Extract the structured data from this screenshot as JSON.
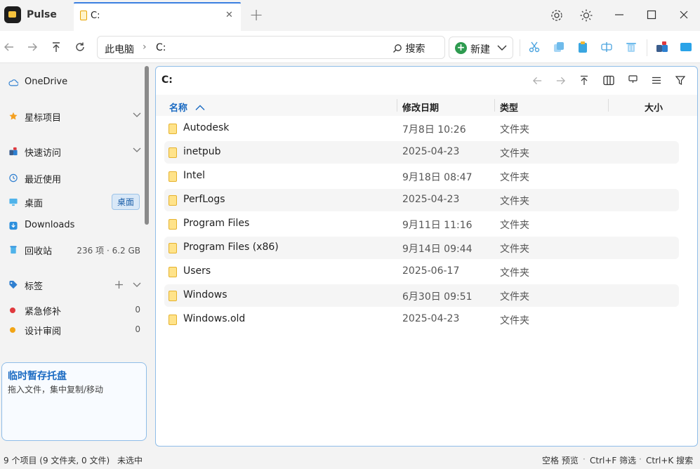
{
  "app": {
    "title": "Pulse"
  },
  "tab": {
    "label": "C:",
    "close": "✕",
    "add": "+"
  },
  "toolbar": {
    "breadcrumb": [
      "此电脑",
      "C:"
    ],
    "search_label": "搜索",
    "new_label": "新建"
  },
  "sidebar": {
    "onedrive": "OneDrive",
    "favorites": "星标项目",
    "quick_access": "快速访问",
    "recent": "最近使用",
    "desktop": "桌面",
    "desktop_badge": "桌面",
    "downloads": "Downloads",
    "recycle": "回收站",
    "recycle_info": "236 项 · 6.2 GB",
    "tags_header": "标签",
    "tags": [
      {
        "label": "紧急修补",
        "count": "0",
        "color": "#e0393e"
      },
      {
        "label": "设计审阅",
        "count": "0",
        "color": "#f2a516"
      }
    ],
    "tray_title": "临时暂存托盘",
    "tray_subtitle": "拖入文件，集中复制/移动"
  },
  "pane": {
    "path": "C:",
    "columns": {
      "name": "名称",
      "date": "修改日期",
      "type": "类型",
      "size": "大小"
    },
    "rows": [
      {
        "name": "Autodesk",
        "date": "7月8日 10:26",
        "type": "文件夹"
      },
      {
        "name": "inetpub",
        "date": "2025-04-23",
        "type": "文件夹"
      },
      {
        "name": "Intel",
        "date": "9月18日 08:47",
        "type": "文件夹"
      },
      {
        "name": "PerfLogs",
        "date": "2025-04-23",
        "type": "文件夹"
      },
      {
        "name": "Program Files",
        "date": "9月11日 11:16",
        "type": "文件夹"
      },
      {
        "name": "Program Files (x86)",
        "date": "9月14日 09:44",
        "type": "文件夹"
      },
      {
        "name": "Users",
        "date": "2025-06-17",
        "type": "文件夹"
      },
      {
        "name": "Windows",
        "date": "6月30日 09:51",
        "type": "文件夹"
      },
      {
        "name": "Windows.old",
        "date": "2025-04-23",
        "type": "文件夹"
      }
    ]
  },
  "status": {
    "summary": "9 个项目 (9 文件夹, 0 文件)",
    "selection": "未选中",
    "hint_preview": "空格 预览",
    "hint_filter": "Ctrl+F 筛选",
    "hint_search": "Ctrl+K 搜索",
    "hint_sep": "·"
  },
  "colors": {
    "accent": "#3b7fe0",
    "folder": "#ffe38a",
    "new_button": "#2e9b50"
  }
}
